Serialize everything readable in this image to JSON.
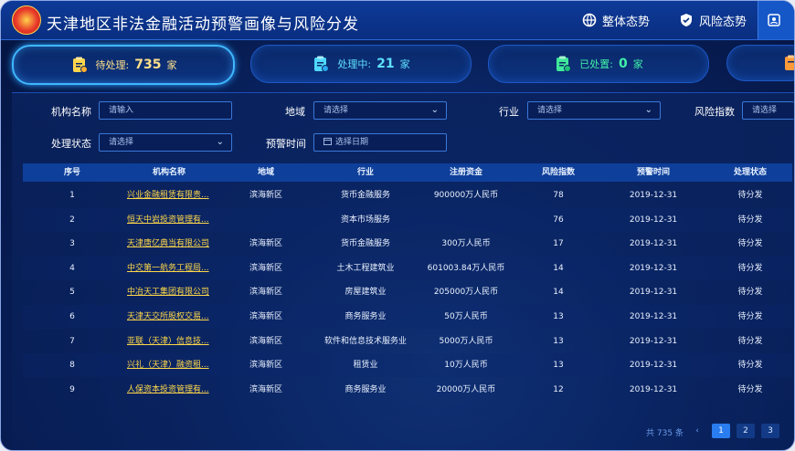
{
  "header": {
    "title": "天津地区非法金融活动预警画像与风险分发",
    "nav": [
      {
        "label": "整体态势",
        "icon": "globe-icon"
      },
      {
        "label": "风险态势",
        "icon": "shield-check-icon"
      },
      {
        "label": "",
        "icon": "org-icon"
      }
    ]
  },
  "cards": [
    {
      "label": "待处理:",
      "value": "735",
      "unit": "家",
      "color": "#ffe08a",
      "icon": "clipboard-pending-icon"
    },
    {
      "label": "处理中:",
      "value": "21",
      "unit": "家",
      "color": "#5fe0ff",
      "icon": "clipboard-processing-icon"
    },
    {
      "label": "已处置:",
      "value": "0",
      "unit": "家",
      "color": "#40f0a8",
      "icon": "clipboard-done-icon"
    },
    {
      "label": "",
      "value": "",
      "unit": "",
      "color": "#ff9a3a",
      "icon": "clipboard-icon"
    }
  ],
  "filters": {
    "org_name_label": "机构名称",
    "org_name_placeholder": "请输入",
    "region_label": "地域",
    "region_value": "请选择",
    "industry_label": "行业",
    "industry_value": "请选择",
    "risk_label": "风险指数",
    "risk_value": "请选择",
    "status_label": "处理状态",
    "status_value": "请选择",
    "date_label": "预警时间",
    "date_placeholder": "选择日期"
  },
  "table": {
    "columns": [
      "序号",
      "机构名称",
      "地域",
      "行业",
      "注册资金",
      "风险指数",
      "预警时间",
      "处理状态"
    ],
    "rows": [
      [
        "1",
        "兴业金融租赁有限责...",
        "滨海新区",
        "货币金融服务",
        "900000万人民币",
        "78",
        "2019-12-31",
        "待分发"
      ],
      [
        "2",
        "恒天中岩投资管理有...",
        "",
        "资本市场服务",
        "",
        "76",
        "2019-12-31",
        "待分发"
      ],
      [
        "3",
        "天津唐亿典当有限公司",
        "滨海新区",
        "货币金融服务",
        "300万人民币",
        "17",
        "2019-12-31",
        "待分发"
      ],
      [
        "4",
        "中交第一航务工程局...",
        "滨海新区",
        "土木工程建筑业",
        "601003.84万人民币",
        "14",
        "2019-12-31",
        "待分发"
      ],
      [
        "5",
        "中冶天工集团有限公司",
        "滨海新区",
        "房屋建筑业",
        "205000万人民币",
        "14",
        "2019-12-31",
        "待分发"
      ],
      [
        "6",
        "天津天交所股权交易...",
        "滨海新区",
        "商务服务业",
        "50万人民币",
        "13",
        "2019-12-31",
        "待分发"
      ],
      [
        "7",
        "亚联（天津）信息技...",
        "滨海新区",
        "软件和信息技术服务业",
        "5000万人民币",
        "13",
        "2019-12-31",
        "待分发"
      ],
      [
        "8",
        "兴礼（天津）融资租...",
        "滨海新区",
        "租赁业",
        "10万人民币",
        "13",
        "2019-12-31",
        "待分发"
      ],
      [
        "9",
        "人保资本投资管理有...",
        "滨海新区",
        "商务服务业",
        "20000万人民币",
        "12",
        "2019-12-31",
        "待分发"
      ]
    ]
  },
  "pagination": {
    "total": "共 735 条",
    "prev": "‹",
    "pages": [
      "1",
      "2",
      "3"
    ],
    "current": "1"
  }
}
